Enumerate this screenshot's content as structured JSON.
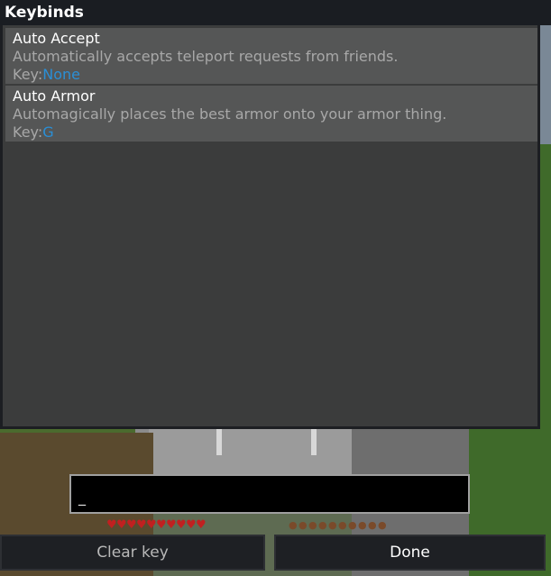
{
  "window": {
    "title": "Keybinds"
  },
  "keybinds": [
    {
      "name": "Auto Accept",
      "description": "Automatically accepts teleport requests from friends.",
      "key_label": "Key:",
      "key_value": "None"
    },
    {
      "name": "Auto Armor",
      "description": "Automagically places the best armor onto your armor thing.",
      "key_label": "Key:",
      "key_value": "G"
    }
  ],
  "key_input": {
    "value": "_"
  },
  "hud": {
    "hearts": 10,
    "hunger": 10,
    "heart_icon": "heart-icon",
    "hunger_icon": "drumstick-icon"
  },
  "buttons": {
    "clear_label": "Clear key",
    "done_label": "Done"
  },
  "colors": {
    "key_value": "#2a8fd6",
    "panel_bg": "#3b3c3c",
    "item_bg": "#555656"
  }
}
